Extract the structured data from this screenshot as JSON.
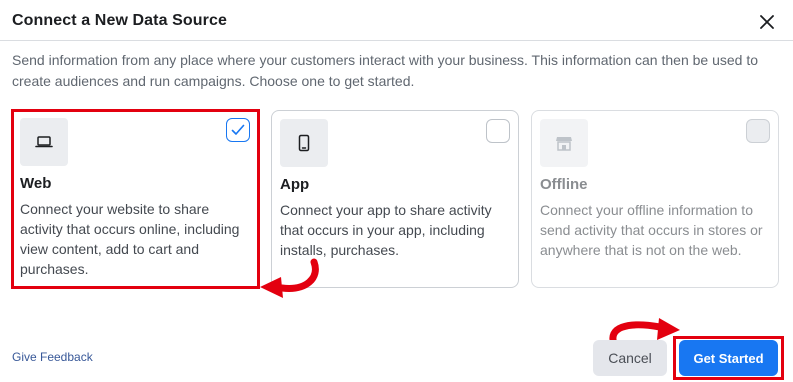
{
  "dialog": {
    "title": "Connect a New Data Source",
    "description": "Send information from any place where your customers interact with your business. This information can then be used to create audiences and run campaigns. Choose one to get started."
  },
  "options": [
    {
      "key": "web",
      "title": "Web",
      "description": "Connect your website to share activity that occurs online, including view content, add to cart and purchases.",
      "icon": "laptop-icon",
      "selected": true,
      "disabled": false
    },
    {
      "key": "app",
      "title": "App",
      "description": "Connect your app to share activity that occurs in your app, including installs, purchases.",
      "icon": "mobile-phone-icon",
      "selected": false,
      "disabled": false
    },
    {
      "key": "offline",
      "title": "Offline",
      "description": "Connect your offline information to send activity that occurs in stores or anywhere that is not on the web.",
      "icon": "store-icon",
      "selected": false,
      "disabled": true
    }
  ],
  "footer": {
    "feedback_label": "Give Feedback",
    "cancel_label": "Cancel",
    "start_label": "Get Started"
  },
  "colors": {
    "accent": "#1877f2",
    "annotation": "#e3000f"
  }
}
